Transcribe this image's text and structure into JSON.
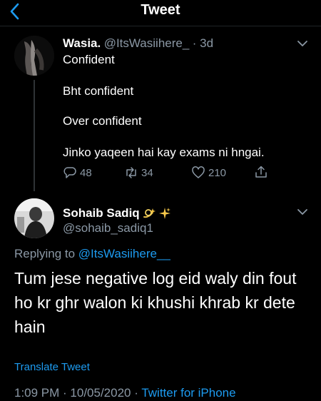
{
  "header": {
    "title": "Tweet"
  },
  "tweet1": {
    "name": "Wasia.",
    "handle": "@ItsWasiihere_",
    "time": "· 3d",
    "lines": [
      "Confident",
      "Bht confident",
      "Over confident",
      "Jinko yaqeen hai kay exams ni hngai."
    ],
    "replies": "48",
    "retweets": "34",
    "likes": "210"
  },
  "tweet2": {
    "name": "Sohaib Sadiq",
    "handle": "@sohaib_sadiq1",
    "emojis": [
      "dizzy-emoji",
      "sparkles-emoji"
    ],
    "replying_label": "Replying to",
    "replying_handle": "@ItsWasiihere__",
    "text": "Tum jese negative log eid waly din fout ho kr ghr walon ki khushi khrab kr dete hain",
    "translate": "Translate Tweet",
    "timestamp": "1:09 PM · 10/05/2020 ·",
    "source": "Twitter for iPhone"
  },
  "colors": {
    "accent": "#1d9bf0",
    "muted": "#8b98a5",
    "background": "#000000"
  }
}
